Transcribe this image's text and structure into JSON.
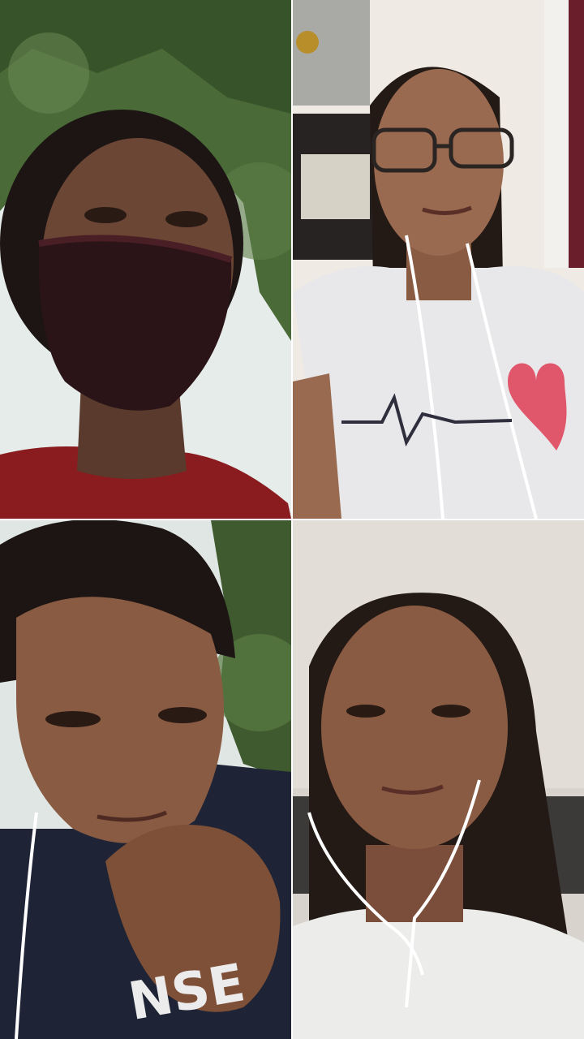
{
  "call": {
    "participants": [
      {
        "name": "",
        "scene": "outdoor-trees",
        "mask": "dark-maroon",
        "shirt": "red"
      },
      {
        "name": "",
        "scene": "indoor-shelves",
        "glasses": true,
        "shirt": "white-heart-print"
      },
      {
        "name": "",
        "scene": "outdoor-trees",
        "hand_on_chin": true,
        "shirt": "navy"
      },
      {
        "name": "",
        "scene": "indoor-wall",
        "earphones": true,
        "shirt": "white"
      }
    ],
    "shirt_print_text": "NSE"
  },
  "colors": {
    "divider": "#ffffff",
    "tree_green": "#3f5a2e",
    "sky": "#dfe6e3",
    "skin_dark": "#6b4634",
    "skin_medium": "#8a5b43",
    "hair": "#1c1513",
    "mask": "#2a1417",
    "maroon_shirt": "#8a1c20",
    "heart": "#e0566a",
    "navy_shirt": "#1e2435",
    "wall": "#d8d3cc",
    "white_shirt": "#ececea"
  }
}
